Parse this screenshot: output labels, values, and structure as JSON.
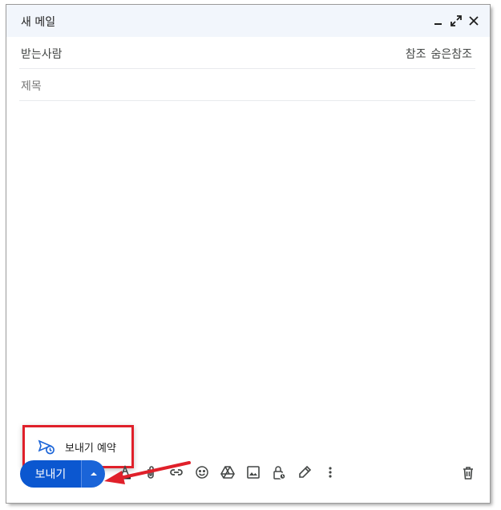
{
  "window": {
    "title": "새 메일",
    "minimize_icon": "minimize-icon",
    "expand_icon": "expand-icon",
    "close_icon": "close-icon"
  },
  "fields": {
    "to_label": "받는사람",
    "cc_label": "참조",
    "bcc_label": "숨은참조",
    "subject_placeholder": "제목"
  },
  "footer": {
    "send_label": "보내기",
    "send_options_icon": "caret-down-icon",
    "tools": [
      "text-color-icon",
      "attach-icon",
      "link-icon",
      "emoji-icon",
      "drive-icon",
      "image-icon",
      "confidential-mode-icon",
      "signature-icon",
      "more-options-icon"
    ],
    "trash_icon": "trash-icon"
  },
  "schedule_menu": {
    "label": "보내기 예약",
    "icon": "schedule-send-icon"
  },
  "colors": {
    "send_button": "#0b57d0",
    "highlight_box": "#e0202a",
    "annotation_arrow": "#e0202a",
    "titlebar_bg": "#f2f6fc"
  }
}
